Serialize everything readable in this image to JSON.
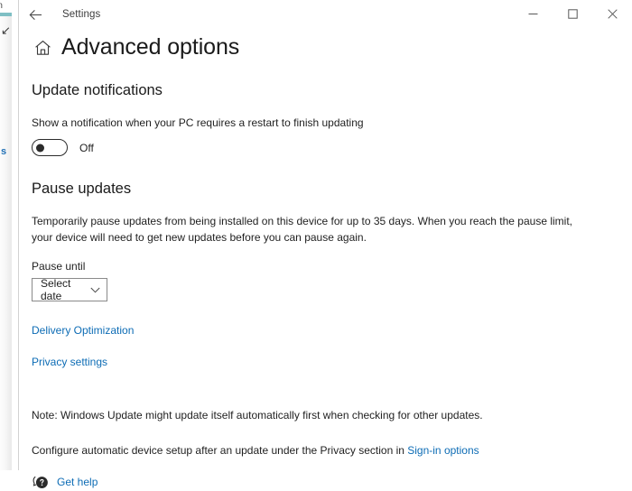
{
  "desktop": {
    "background_fragments": [
      {
        "name": "bg-text-fragment-top",
        "text": "rn"
      },
      {
        "name": "bg-glyph-fragment",
        "text": "↙"
      },
      {
        "name": "bg-link-fragment",
        "text": "s"
      }
    ]
  },
  "window": {
    "title": "Settings",
    "back_icon": "back-arrow-icon",
    "controls": {
      "minimize": "minimize-icon",
      "maximize": "maximize-icon",
      "close": "close-icon"
    }
  },
  "page": {
    "home_icon": "home-icon",
    "title": "Advanced options"
  },
  "update_notifications": {
    "heading": "Update notifications",
    "description": "Show a notification when your PC requires a restart to finish updating",
    "toggle": {
      "state_label": "Off",
      "checked": false
    }
  },
  "pause_updates": {
    "heading": "Pause updates",
    "description": "Temporarily pause updates from being installed on this device for up to 35 days. When you reach the pause limit, your device will need to get new updates before you can pause again.",
    "pause_until_label": "Pause until",
    "dropdown": {
      "selected": "Select date",
      "chevron_icon": "chevron-down-icon"
    }
  },
  "links": {
    "delivery_optimization": "Delivery Optimization",
    "privacy_settings": "Privacy settings"
  },
  "footer": {
    "note": "Note: Windows Update might update itself automatically first when checking for other updates.",
    "configure_prefix": "Configure automatic device setup after an update under the Privacy section in ",
    "sign_in_options_link": "Sign-in options",
    "get_help_icon": "help-bubble-icon",
    "get_help_label": "Get help"
  },
  "colors": {
    "accent_link": "#0d6cb5",
    "window_background": "#ffffff",
    "text_primary": "#1f1f1f"
  }
}
